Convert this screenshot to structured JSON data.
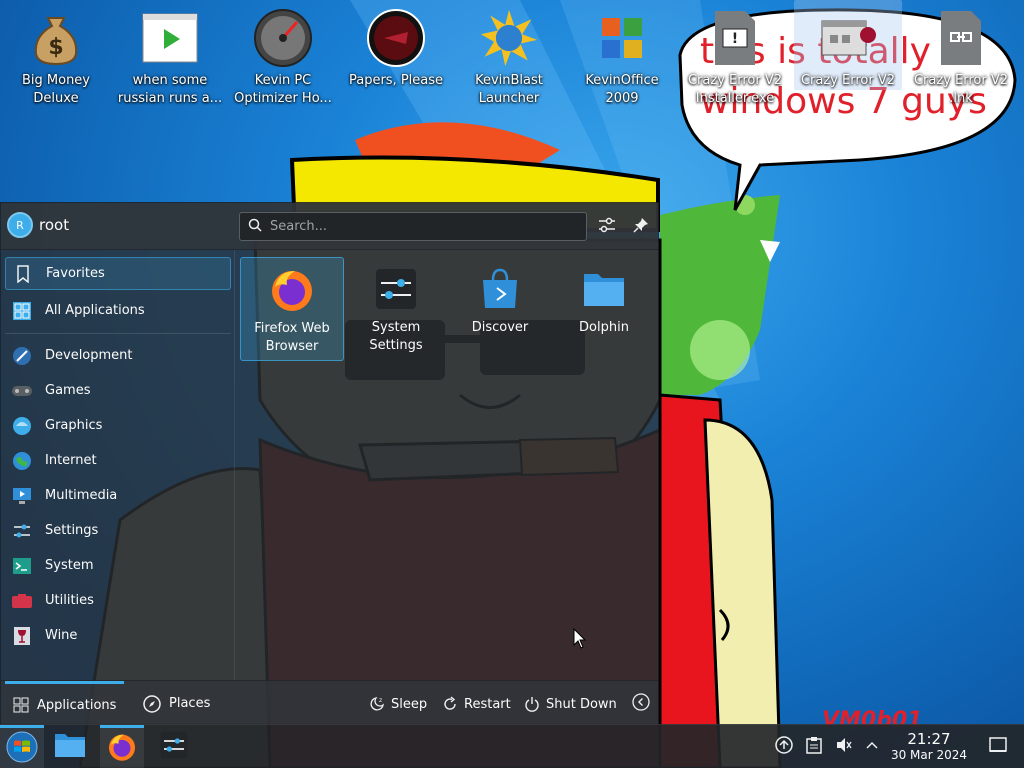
{
  "desktop": {
    "icons": [
      {
        "label": "Big Money\nDeluxe",
        "icon": "money-bag-icon"
      },
      {
        "label": "when some\nrussian runs a...",
        "icon": "video-play-icon"
      },
      {
        "label": "Kevin PC\nOptimizer Ho...",
        "icon": "speedometer-icon"
      },
      {
        "label": "Papers, Please",
        "icon": "papers-please-icon"
      },
      {
        "label": "KevinBlast\nLauncher",
        "icon": "blast-launcher-icon"
      },
      {
        "label": "KevinOffice\n2009",
        "icon": "office-icon"
      },
      {
        "label": "Crazy Error V2\nInstaller.exe",
        "icon": "exe-file-icon"
      },
      {
        "label": "Crazy Error V2",
        "icon": "wine-app-icon"
      },
      {
        "label": "Crazy Error V2\n.lnk",
        "icon": "link-file-icon"
      }
    ],
    "wallpaper_text": {
      "speech_bubble": "this is totally\nwindows 7 guys",
      "signature": "VM0b01"
    }
  },
  "launcher": {
    "user": {
      "name": "root",
      "initial": "R"
    },
    "search": {
      "placeholder": "Search..."
    },
    "categories": [
      {
        "label": "Favorites",
        "icon": "bookmark-icon"
      },
      {
        "label": "All Applications",
        "icon": "grid-icon"
      },
      {
        "label": "Development",
        "icon": "development-icon"
      },
      {
        "label": "Games",
        "icon": "gamepad-icon"
      },
      {
        "label": "Graphics",
        "icon": "graphics-icon"
      },
      {
        "label": "Internet",
        "icon": "globe-icon"
      },
      {
        "label": "Multimedia",
        "icon": "multimedia-icon"
      },
      {
        "label": "Settings",
        "icon": "settings-icon"
      },
      {
        "label": "System",
        "icon": "system-icon"
      },
      {
        "label": "Utilities",
        "icon": "utilities-icon"
      },
      {
        "label": "Wine",
        "icon": "wine-icon"
      }
    ],
    "favorites": [
      {
        "label": "Firefox Web\nBrowser",
        "icon": "firefox-icon"
      },
      {
        "label": "System\nSettings",
        "icon": "system-settings-icon"
      },
      {
        "label": "Discover",
        "icon": "discover-icon"
      },
      {
        "label": "Dolphin",
        "icon": "folder-icon"
      }
    ],
    "footer": {
      "tabs": [
        {
          "label": "Applications"
        },
        {
          "label": "Places"
        }
      ],
      "actions": [
        {
          "label": "Sleep"
        },
        {
          "label": "Restart"
        },
        {
          "label": "Shut Down"
        }
      ]
    }
  },
  "taskbar": {
    "clock": {
      "time": "21:27",
      "date": "30 Mar 2024"
    }
  },
  "colors": {
    "accent": "#3daee9",
    "panel": "#2a2e32"
  }
}
